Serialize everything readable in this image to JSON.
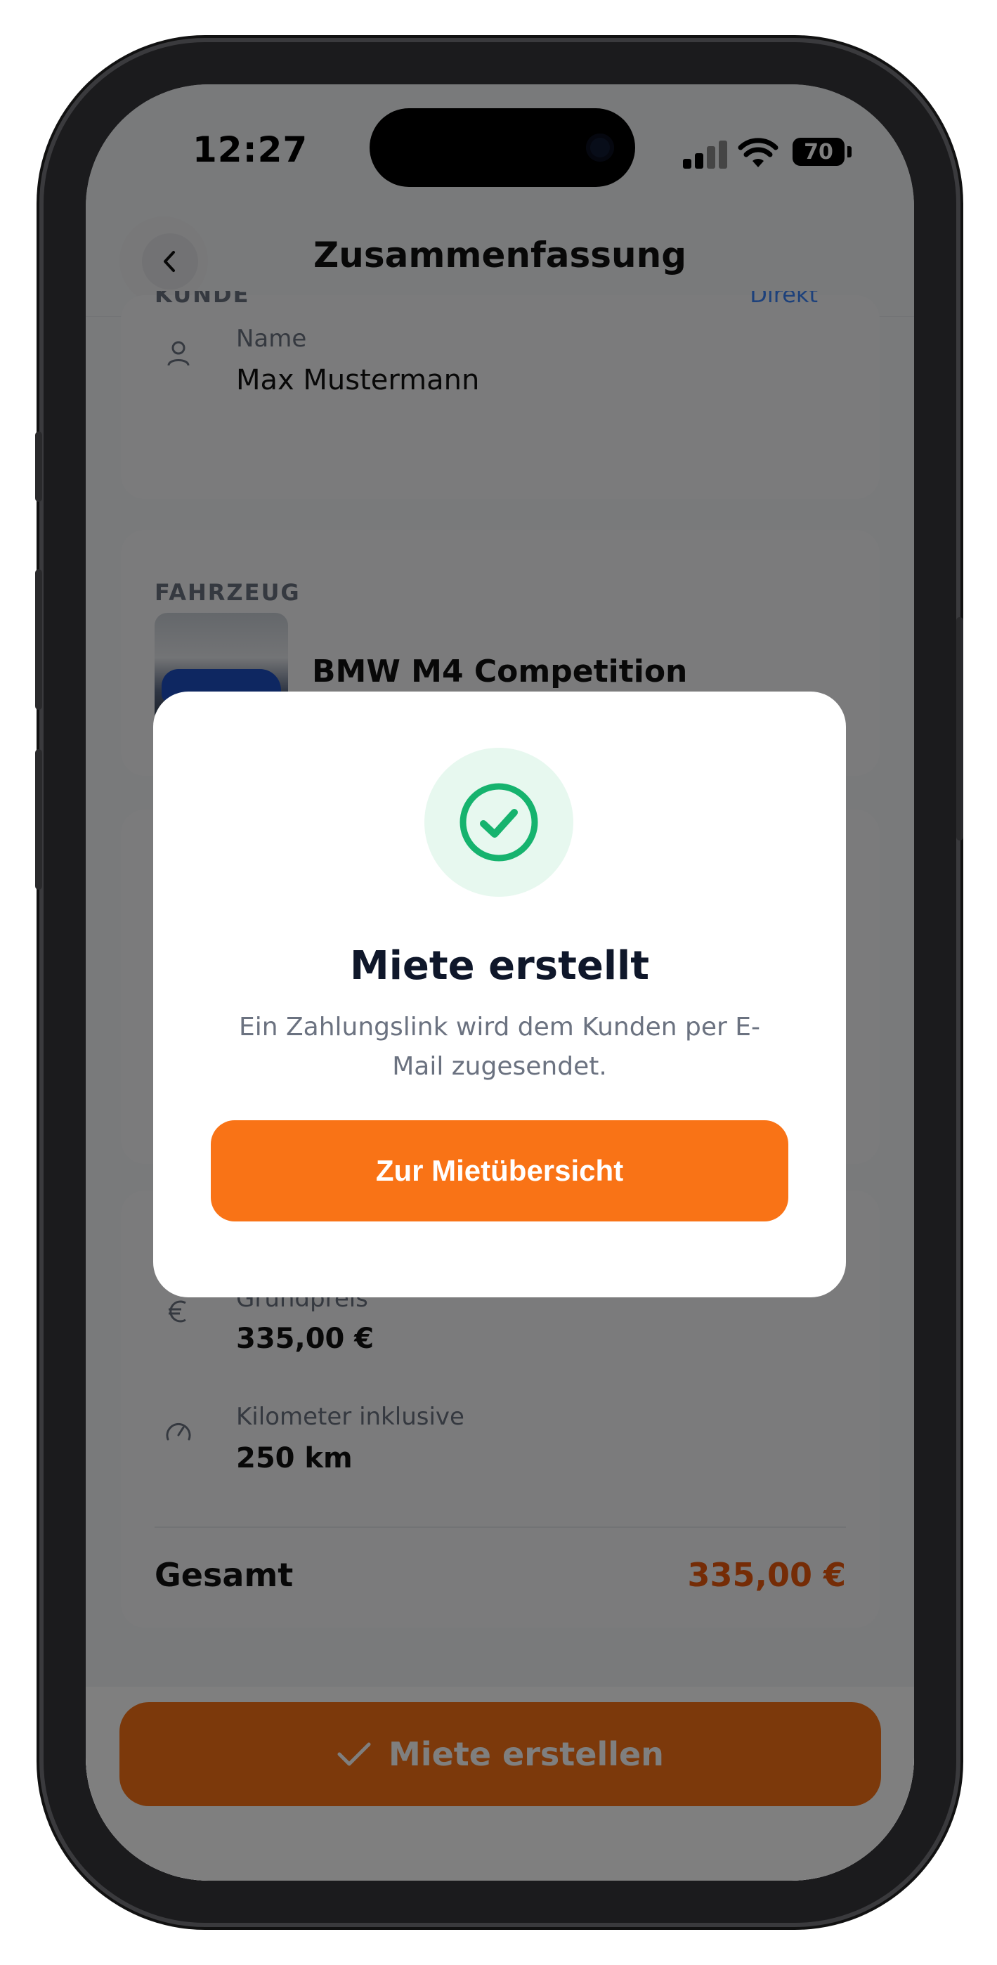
{
  "status_bar": {
    "time": "12:27",
    "battery": "70"
  },
  "header": {
    "title": "Zusammenfassung"
  },
  "customer": {
    "section_label": "KUNDE",
    "badge": "Direkt",
    "name_label": "Name",
    "name_value": "Max Mustermann"
  },
  "vehicle": {
    "section_label": "FAHRZEUG",
    "name": "BMW M4 Competition"
  },
  "pricing": {
    "base_price_label": "Grundpreis",
    "base_price_value": "335,00 €",
    "km_label": "Kilometer inklusive",
    "km_value": "250 km",
    "total_label": "Gesamt",
    "total_value": "335,00 €"
  },
  "create_button": {
    "label": "Miete erstellen"
  },
  "modal": {
    "title": "Miete erstellt",
    "text": "Ein Zahlungslink wird dem Kunden per E-Mail zugesendet.",
    "button_label": "Zur Mietübersicht"
  },
  "colors": {
    "accent": "#f97316",
    "success": "#16b36e",
    "total": "#ea580c"
  }
}
